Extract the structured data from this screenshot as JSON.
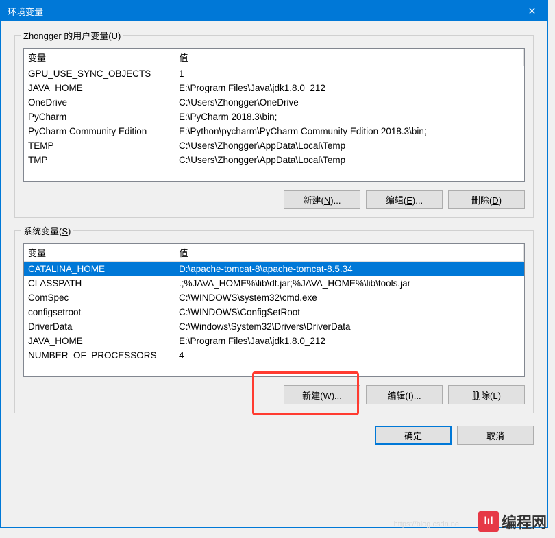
{
  "window": {
    "title": "环境变量",
    "close": "✕"
  },
  "user_section": {
    "label_pre": "Zhongger 的用户变量(",
    "label_hot": "U",
    "label_post": ")",
    "headers": {
      "var": "变量",
      "val": "值"
    },
    "rows": [
      {
        "var": "GPU_USE_SYNC_OBJECTS",
        "val": "1"
      },
      {
        "var": "JAVA_HOME",
        "val": "E:\\Program Files\\Java\\jdk1.8.0_212"
      },
      {
        "var": "OneDrive",
        "val": "C:\\Users\\Zhongger\\OneDrive"
      },
      {
        "var": "PyCharm",
        "val": "E:\\PyCharm 2018.3\\bin;"
      },
      {
        "var": "PyCharm Community Edition",
        "val": "E:\\Python\\pycharm\\PyCharm Community Edition 2018.3\\bin;"
      },
      {
        "var": "TEMP",
        "val": "C:\\Users\\Zhongger\\AppData\\Local\\Temp"
      },
      {
        "var": "TMP",
        "val": "C:\\Users\\Zhongger\\AppData\\Local\\Temp"
      }
    ],
    "buttons": {
      "new_pre": "新建(",
      "new_hot": "N",
      "new_post": ")...",
      "edit_pre": "编辑(",
      "edit_hot": "E",
      "edit_post": ")...",
      "del_pre": "删除(",
      "del_hot": "D",
      "del_post": ")"
    }
  },
  "system_section": {
    "label_pre": "系统变量(",
    "label_hot": "S",
    "label_post": ")",
    "headers": {
      "var": "变量",
      "val": "值"
    },
    "rows": [
      {
        "var": "CATALINA_HOME",
        "val": "D:\\apache-tomcat-8\\apache-tomcat-8.5.34",
        "selected": true
      },
      {
        "var": "CLASSPATH",
        "val": ".;%JAVA_HOME%\\lib\\dt.jar;%JAVA_HOME%\\lib\\tools.jar"
      },
      {
        "var": "ComSpec",
        "val": "C:\\WINDOWS\\system32\\cmd.exe"
      },
      {
        "var": "configsetroot",
        "val": "C:\\WINDOWS\\ConfigSetRoot"
      },
      {
        "var": "DriverData",
        "val": "C:\\Windows\\System32\\Drivers\\DriverData"
      },
      {
        "var": "JAVA_HOME",
        "val": "E:\\Program Files\\Java\\jdk1.8.0_212"
      },
      {
        "var": "NUMBER_OF_PROCESSORS",
        "val": "4"
      }
    ],
    "buttons": {
      "new_pre": "新建(",
      "new_hot": "W",
      "new_post": ")...",
      "edit_pre": "编辑(",
      "edit_hot": "I",
      "edit_post": ")...",
      "del_pre": "删除(",
      "del_hot": "L",
      "del_post": ")"
    }
  },
  "dialog_buttons": {
    "ok": "确定",
    "cancel": "取消"
  },
  "watermark": {
    "icon": "lıl",
    "text": "编程网"
  },
  "faint_url": "https://blog.csdn.ne"
}
